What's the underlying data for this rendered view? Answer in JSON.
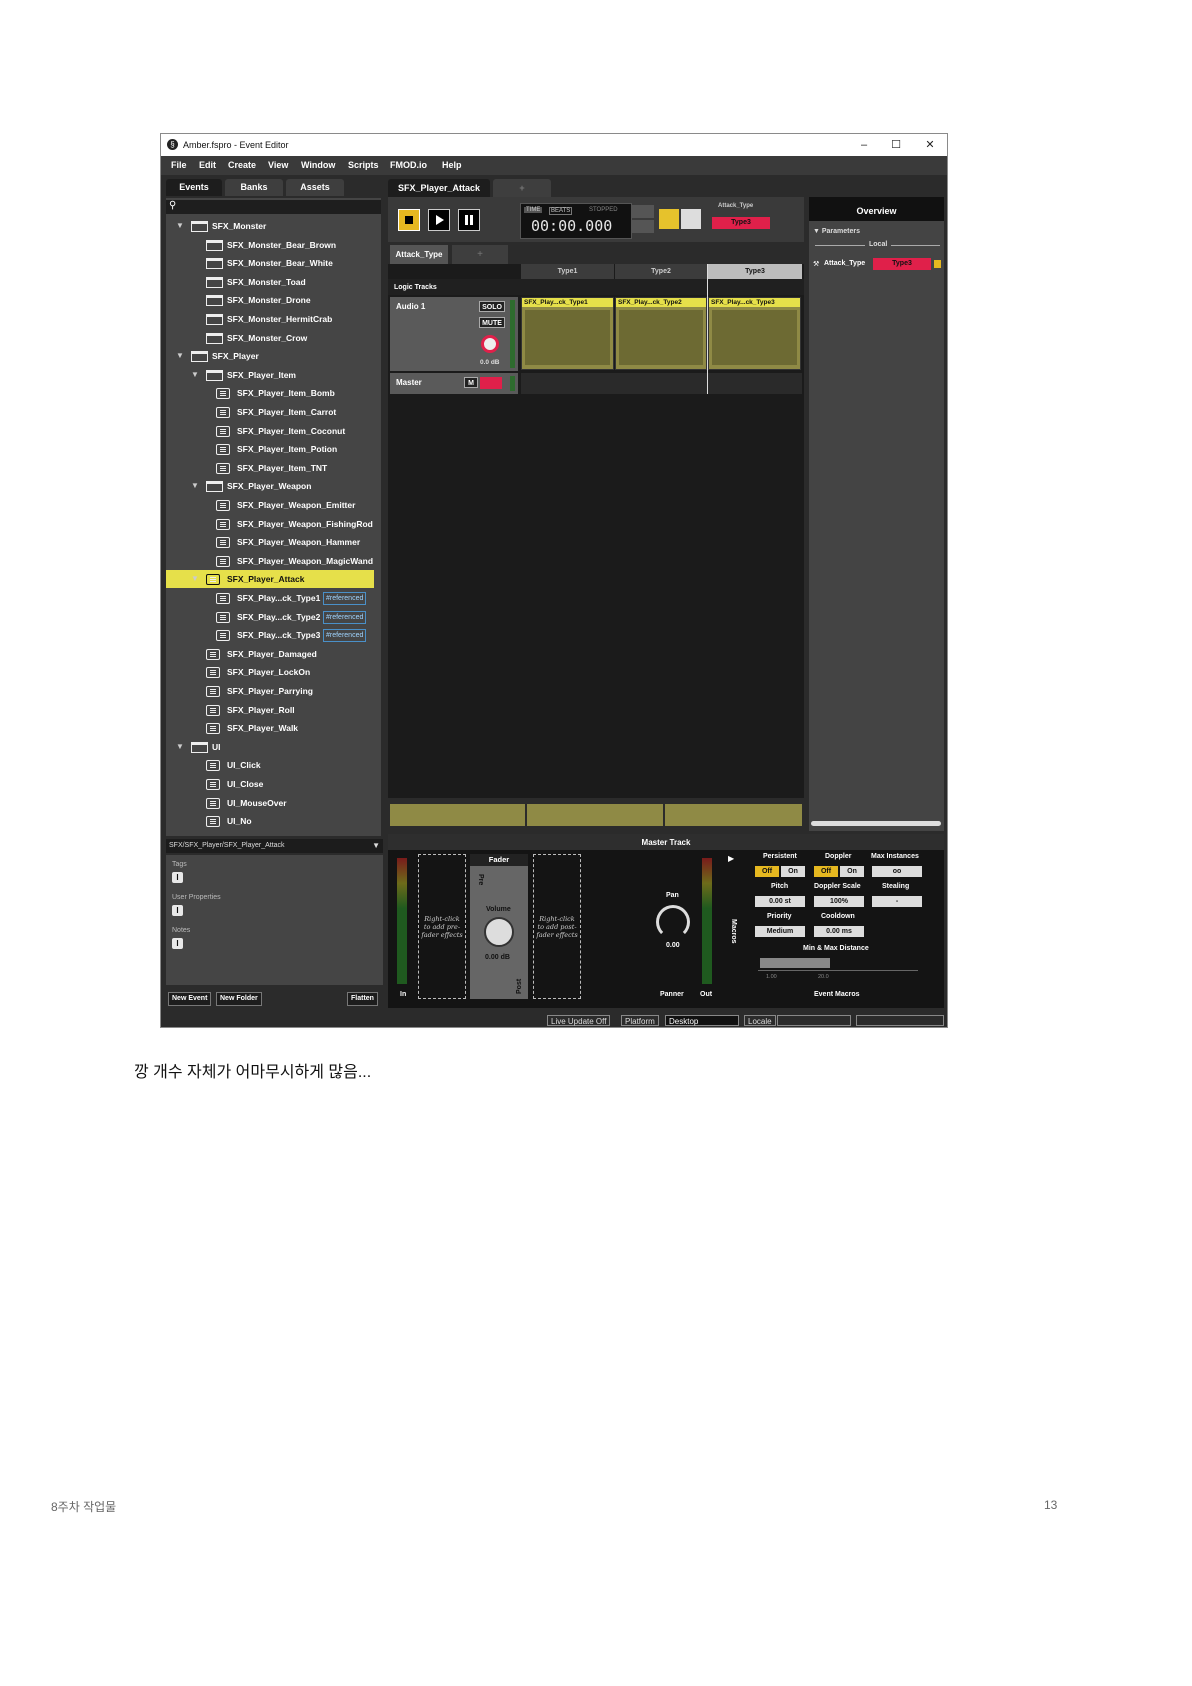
{
  "window": {
    "title": "Amber.fspro - Event Editor",
    "minimize": "–",
    "maximize": "☐",
    "close": "✕"
  },
  "menu": [
    "File",
    "Edit",
    "Create",
    "View",
    "Window",
    "Scripts",
    "FMOD.io",
    "Help"
  ],
  "browser_tabs": [
    "Events",
    "Banks",
    "Assets"
  ],
  "tree": [
    {
      "label": "SFX_Monster",
      "type": "folder",
      "depth": 0,
      "expanded": true
    },
    {
      "label": "SFX_Monster_Bear_Brown",
      "type": "folder",
      "depth": 1
    },
    {
      "label": "SFX_Monster_Bear_White",
      "type": "folder",
      "depth": 1
    },
    {
      "label": "SFX_Monster_Toad",
      "type": "folder",
      "depth": 1
    },
    {
      "label": "SFX_Monster_Drone",
      "type": "folder",
      "depth": 1
    },
    {
      "label": "SFX_Monster_HermitCrab",
      "type": "folder",
      "depth": 1
    },
    {
      "label": "SFX_Monster_Crow",
      "type": "folder",
      "depth": 1
    },
    {
      "label": "SFX_Player",
      "type": "folder",
      "depth": 0,
      "expanded": true
    },
    {
      "label": "SFX_Player_Item",
      "type": "folder",
      "depth": 1,
      "expanded": true
    },
    {
      "label": "SFX_Player_Item_Bomb",
      "type": "event",
      "depth": 2
    },
    {
      "label": "SFX_Player_Item_Carrot",
      "type": "event",
      "depth": 2
    },
    {
      "label": "SFX_Player_Item_Coconut",
      "type": "event",
      "depth": 2
    },
    {
      "label": "SFX_Player_Item_Potion",
      "type": "event",
      "depth": 2
    },
    {
      "label": "SFX_Player_Item_TNT",
      "type": "event",
      "depth": 2
    },
    {
      "label": "SFX_Player_Weapon",
      "type": "folder",
      "depth": 1,
      "expanded": true
    },
    {
      "label": "SFX_Player_Weapon_Emitter",
      "type": "event",
      "depth": 2
    },
    {
      "label": "SFX_Player_Weapon_FishingRod",
      "type": "event",
      "depth": 2
    },
    {
      "label": "SFX_Player_Weapon_Hammer",
      "type": "event",
      "depth": 2
    },
    {
      "label": "SFX_Player_Weapon_MagicWand",
      "type": "event",
      "depth": 2
    },
    {
      "label": "SFX_Player_Attack",
      "type": "event",
      "depth": 1,
      "expanded": true,
      "selected": true
    },
    {
      "label": "SFX_Play...ck_Type1",
      "type": "event",
      "depth": 2,
      "badge": "#referenced"
    },
    {
      "label": "SFX_Play...ck_Type2",
      "type": "event",
      "depth": 2,
      "badge": "#referenced"
    },
    {
      "label": "SFX_Play...ck_Type3",
      "type": "event",
      "depth": 2,
      "badge": "#referenced"
    },
    {
      "label": "SFX_Player_Damaged",
      "type": "event",
      "depth": 1
    },
    {
      "label": "SFX_Player_LockOn",
      "type": "event",
      "depth": 1
    },
    {
      "label": "SFX_Player_Parrying",
      "type": "event",
      "depth": 1
    },
    {
      "label": "SFX_Player_Roll",
      "type": "event",
      "depth": 1
    },
    {
      "label": "SFX_Player_Walk",
      "type": "event",
      "depth": 1
    },
    {
      "label": "UI",
      "type": "folder",
      "depth": 0,
      "expanded": true
    },
    {
      "label": "UI_Click",
      "type": "event",
      "depth": 1
    },
    {
      "label": "UI_Close",
      "type": "event",
      "depth": 1
    },
    {
      "label": "UI_MouseOver",
      "type": "event",
      "depth": 1
    },
    {
      "label": "UI_No",
      "type": "event",
      "depth": 1
    }
  ],
  "path": "SFX/SFX_Player/SFX_Player_Attack",
  "props": {
    "tags": "Tags",
    "user_properties": "User Properties",
    "notes": "Notes"
  },
  "browser_buttons": {
    "new_event": "New Event",
    "new_folder": "New Folder",
    "flatten": "Flatten"
  },
  "editor": {
    "event_tab": "SFX_Player_Attack",
    "add_tab": "+",
    "time_mode": "TIME",
    "beats_mode": "BEATS",
    "state": "STOPPED",
    "timecode": "00:00.000",
    "param_name": "Attack_Type",
    "param_value": "Type3",
    "sheet_tab": "Attack_Type",
    "sheet_add": "+",
    "columns": [
      "Type1",
      "Type2",
      "Type3"
    ],
    "logic_tracks": "Logic Tracks",
    "track": {
      "name": "Audio 1",
      "solo": "SOLO",
      "mute": "MUTE",
      "volume": "0.0 dB"
    },
    "master": {
      "name": "Master",
      "mute": "M"
    },
    "instruments": [
      "SFX_Play...ck_Type1",
      "SFX_Play...ck_Type2",
      "SFX_Play...ck_Type3"
    ]
  },
  "overview": {
    "title": "Overview",
    "parameters": "▼ Parameters",
    "local": "Local",
    "param": "Attack_Type",
    "value": "Type3"
  },
  "deck": {
    "title": "Master Track",
    "fader": "Fader",
    "pre": "Pre",
    "post": "Post",
    "volume": "Volume",
    "volume_value": "0.00 dB",
    "pre_hint": "Right-click to add pre-fader effects",
    "post_hint": "Right-click to add post-fader effects",
    "in": "In",
    "pan": "Pan",
    "pan_value": "0.00",
    "panner": "Panner",
    "out": "Out",
    "macros": "Macros",
    "persistent": "Persistent",
    "doppler": "Doppler",
    "max_instances": "Max Instances",
    "off": "Off",
    "on": "On",
    "max_instances_value": "oo",
    "pitch": "Pitch",
    "pitch_value": "0.00 st",
    "doppler_scale": "Doppler Scale",
    "doppler_scale_value": "100%",
    "stealing": "Stealing",
    "stealing_value": "-",
    "priority": "Priority",
    "priority_value": "Medium",
    "cooldown": "Cooldown",
    "cooldown_value": "0.00 ms",
    "distance": "Min & Max Distance",
    "distance_min": "1.00",
    "distance_max": "20.0",
    "event_macros": "Event Macros"
  },
  "status": {
    "live_update": "Live Update Off",
    "platform_label": "Platform",
    "platform_value": "Desktop",
    "locale_label": "Locale"
  },
  "caption": "깡 개수 자체가 어마무시하게 많음...",
  "footer": {
    "left": "8주차 작업물",
    "right": "13"
  },
  "colors": {
    "accent_yellow": "#e6e04a",
    "param_red": "#e0204a",
    "instrument_olive": "#8f8a45",
    "background": "#2b2b2b"
  }
}
